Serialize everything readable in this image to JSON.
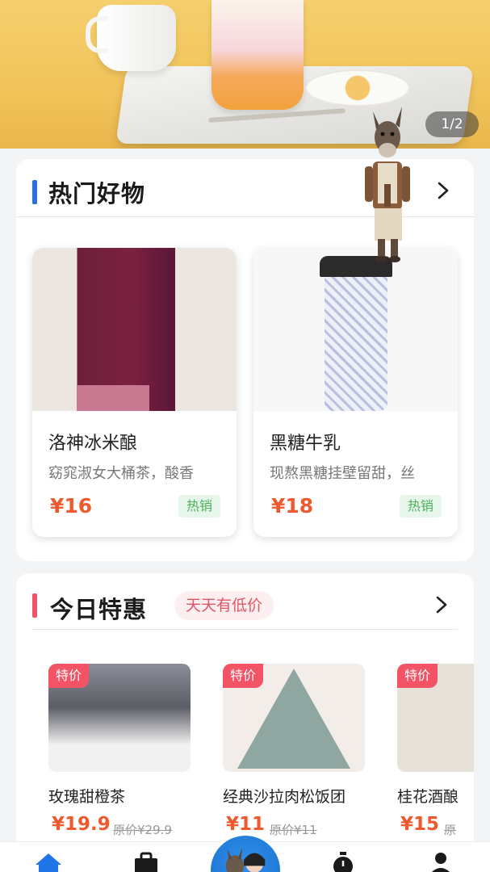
{
  "banner": {
    "pager": "1/2"
  },
  "hot": {
    "title": "热门好物",
    "accent": "#2a6fdb",
    "products": [
      {
        "name": "洛神冰米酿",
        "desc": "窈窕淑女大桶茶，酸香",
        "price": "¥16",
        "badge": "热销"
      },
      {
        "name": "黑糖牛乳",
        "desc": "现熬黑糖挂壁留甜，丝",
        "price": "¥18",
        "badge": "热销"
      }
    ]
  },
  "deals": {
    "title": "今日特惠",
    "tag": "天天有低价",
    "accent": "#f25365",
    "items": [
      {
        "tag": "特价",
        "name": "玫瑰甜橙茶",
        "price": "¥19.9",
        "orig": "原价¥29.9"
      },
      {
        "tag": "特价",
        "name": "经典沙拉肉松饭团",
        "price": "¥11",
        "orig": "原价¥11"
      },
      {
        "tag": "特价",
        "name": "桂花酒酿",
        "price": "¥15",
        "orig": "原"
      }
    ]
  },
  "tabbar": {
    "icons": [
      "home-icon",
      "bag-icon",
      "avatar",
      "timer-icon",
      "profile-icon"
    ]
  }
}
